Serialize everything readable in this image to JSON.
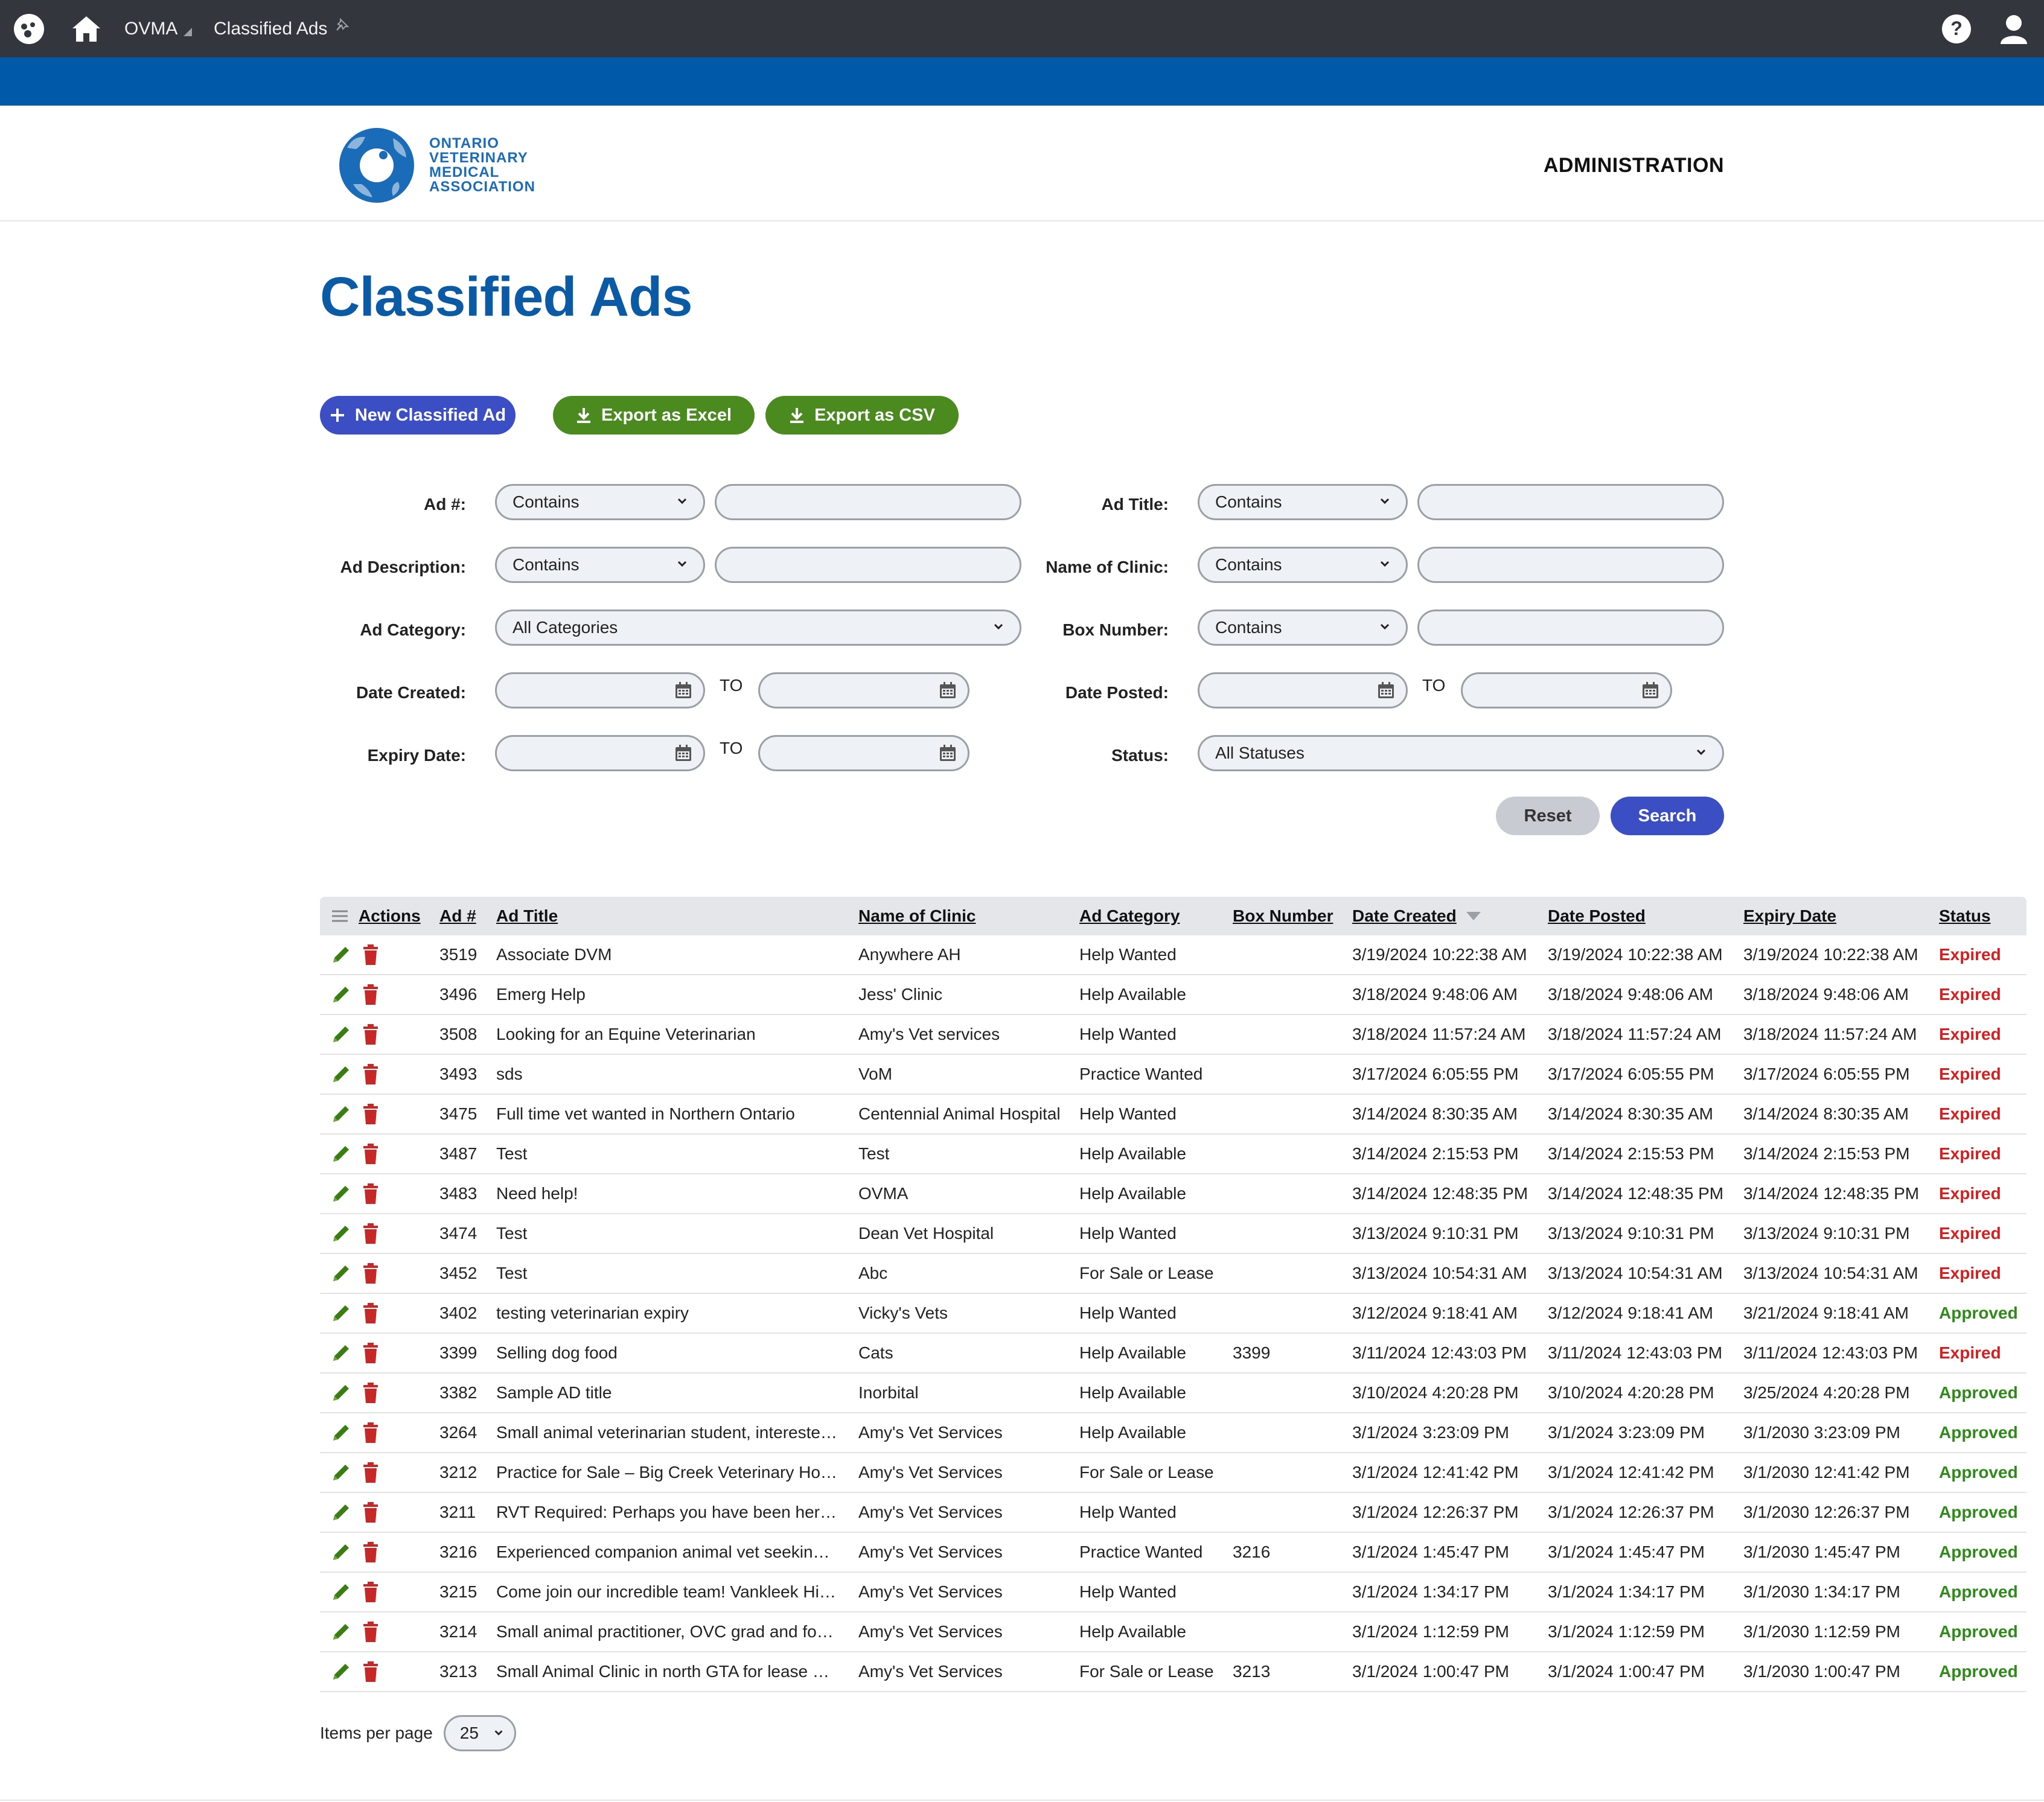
{
  "topbar": {
    "site_name": "OVMA",
    "page_name": "Classified Ads"
  },
  "header": {
    "logo_lines": [
      "ONTARIO",
      "VETERINARY",
      "MEDICAL",
      "ASSOCIATION"
    ],
    "admin_label": "ADMINISTRATION"
  },
  "page": {
    "title": "Classified Ads"
  },
  "toolbar": {
    "new_label": "New Classified Ad",
    "excel_label": "Export as Excel",
    "csv_label": "Export as CSV"
  },
  "filters": {
    "ad_num_label": "Ad #:",
    "ad_num_op": "Contains",
    "ad_title_label": "Ad Title:",
    "ad_title_op": "Contains",
    "ad_desc_label": "Ad Description:",
    "ad_desc_op": "Contains",
    "clinic_label": "Name of Clinic:",
    "clinic_op": "Contains",
    "category_label": "Ad Category:",
    "category_value": "All Categories",
    "box_label": "Box Number:",
    "box_op": "Contains",
    "date_created_label": "Date Created:",
    "date_posted_label": "Date Posted:",
    "expiry_label": "Expiry Date:",
    "status_label": "Status:",
    "status_value": "All Statuses",
    "to_label": "TO",
    "reset_label": "Reset",
    "search_label": "Search"
  },
  "table": {
    "headers": {
      "actions": "Actions",
      "ad_num": "Ad #",
      "title": "Ad Title",
      "clinic": "Name of Clinic",
      "category": "Ad Category",
      "box": "Box Number",
      "created": "Date Created",
      "posted": "Date Posted",
      "expiry": "Expiry Date",
      "status": "Status"
    },
    "rows": [
      {
        "ad_num": "3519",
        "title": "Associate DVM",
        "clinic": "Anywhere AH",
        "category": "Help Wanted",
        "box": "",
        "created": "3/19/2024 10:22:38 AM",
        "posted": "3/19/2024 10:22:38 AM",
        "expiry": "3/19/2024 10:22:38 AM",
        "status": "Expired"
      },
      {
        "ad_num": "3496",
        "title": "Emerg Help",
        "clinic": "Jess' Clinic",
        "category": "Help Available",
        "box": "",
        "created": "3/18/2024 9:48:06 AM",
        "posted": "3/18/2024 9:48:06 AM",
        "expiry": "3/18/2024 9:48:06 AM",
        "status": "Expired"
      },
      {
        "ad_num": "3508",
        "title": "Looking for an Equine Veterinarian",
        "clinic": "Amy's Vet services",
        "category": "Help Wanted",
        "box": "",
        "created": "3/18/2024 11:57:24 AM",
        "posted": "3/18/2024 11:57:24 AM",
        "expiry": "3/18/2024 11:57:24 AM",
        "status": "Expired"
      },
      {
        "ad_num": "3493",
        "title": "sds",
        "clinic": "VoM",
        "category": "Practice Wanted",
        "box": "",
        "created": "3/17/2024 6:05:55 PM",
        "posted": "3/17/2024 6:05:55 PM",
        "expiry": "3/17/2024 6:05:55 PM",
        "status": "Expired"
      },
      {
        "ad_num": "3475",
        "title": "Full time vet wanted in Northern Ontario",
        "clinic": "Centennial Animal Hospital",
        "category": "Help Wanted",
        "box": "",
        "created": "3/14/2024 8:30:35 AM",
        "posted": "3/14/2024 8:30:35 AM",
        "expiry": "3/14/2024 8:30:35 AM",
        "status": "Expired"
      },
      {
        "ad_num": "3487",
        "title": "Test",
        "clinic": "Test",
        "category": "Help Available",
        "box": "",
        "created": "3/14/2024 2:15:53 PM",
        "posted": "3/14/2024 2:15:53 PM",
        "expiry": "3/14/2024 2:15:53 PM",
        "status": "Expired"
      },
      {
        "ad_num": "3483",
        "title": "Need help!",
        "clinic": "OVMA",
        "category": "Help Available",
        "box": "",
        "created": "3/14/2024 12:48:35 PM",
        "posted": "3/14/2024 12:48:35 PM",
        "expiry": "3/14/2024 12:48:35 PM",
        "status": "Expired"
      },
      {
        "ad_num": "3474",
        "title": "Test",
        "clinic": "Dean Vet Hospital",
        "category": "Help Wanted",
        "box": "",
        "created": "3/13/2024 9:10:31 PM",
        "posted": "3/13/2024 9:10:31 PM",
        "expiry": "3/13/2024 9:10:31 PM",
        "status": "Expired"
      },
      {
        "ad_num": "3452",
        "title": "Test",
        "clinic": "Abc",
        "category": "For Sale or Lease",
        "box": "",
        "created": "3/13/2024 10:54:31 AM",
        "posted": "3/13/2024 10:54:31 AM",
        "expiry": "3/13/2024 10:54:31 AM",
        "status": "Expired"
      },
      {
        "ad_num": "3402",
        "title": "testing veterinarian expiry",
        "clinic": "Vicky's Vets",
        "category": "Help Wanted",
        "box": "",
        "created": "3/12/2024 9:18:41 AM",
        "posted": "3/12/2024 9:18:41 AM",
        "expiry": "3/21/2024 9:18:41 AM",
        "status": "Approved"
      },
      {
        "ad_num": "3399",
        "title": "Selling dog food",
        "clinic": "Cats",
        "category": "Help Available",
        "box": "3399",
        "created": "3/11/2024 12:43:03 PM",
        "posted": "3/11/2024 12:43:03 PM",
        "expiry": "3/11/2024 12:43:03 PM",
        "status": "Expired"
      },
      {
        "ad_num": "3382",
        "title": "Sample AD title",
        "clinic": "Inorbital",
        "category": "Help Available",
        "box": "",
        "created": "3/10/2024 4:20:28 PM",
        "posted": "3/10/2024 4:20:28 PM",
        "expiry": "3/25/2024 4:20:28 PM",
        "status": "Approved"
      },
      {
        "ad_num": "3264",
        "title": "Small animal veterinarian student, intereste…",
        "clinic": "Amy's Vet Services",
        "category": "Help Available",
        "box": "",
        "created": "3/1/2024 3:23:09 PM",
        "posted": "3/1/2024 3:23:09 PM",
        "expiry": "3/1/2030 3:23:09 PM",
        "status": "Approved"
      },
      {
        "ad_num": "3212",
        "title": "Practice for Sale – Big Creek Veterinary Ho…",
        "clinic": "Amy's Vet Services",
        "category": "For Sale or Lease",
        "box": "",
        "created": "3/1/2024 12:41:42 PM",
        "posted": "3/1/2024 12:41:42 PM",
        "expiry": "3/1/2030 12:41:42 PM",
        "status": "Approved"
      },
      {
        "ad_num": "3211",
        "title": "RVT Required: Perhaps you have been her…",
        "clinic": "Amy's Vet Services",
        "category": "Help Wanted",
        "box": "",
        "created": "3/1/2024 12:26:37 PM",
        "posted": "3/1/2024 12:26:37 PM",
        "expiry": "3/1/2030 12:26:37 PM",
        "status": "Approved"
      },
      {
        "ad_num": "3216",
        "title": "Experienced companion animal vet seekin…",
        "clinic": "Amy's Vet Services",
        "category": "Practice Wanted",
        "box": "3216",
        "created": "3/1/2024 1:45:47 PM",
        "posted": "3/1/2024 1:45:47 PM",
        "expiry": "3/1/2030 1:45:47 PM",
        "status": "Approved"
      },
      {
        "ad_num": "3215",
        "title": "Come join our incredible team! Vankleek Hi…",
        "clinic": "Amy's Vet Services",
        "category": "Help Wanted",
        "box": "",
        "created": "3/1/2024 1:34:17 PM",
        "posted": "3/1/2024 1:34:17 PM",
        "expiry": "3/1/2030 1:34:17 PM",
        "status": "Approved"
      },
      {
        "ad_num": "3214",
        "title": "Small animal practitioner, OVC grad and fo…",
        "clinic": "Amy's Vet Services",
        "category": "Help Available",
        "box": "",
        "created": "3/1/2024 1:12:59 PM",
        "posted": "3/1/2024 1:12:59 PM",
        "expiry": "3/1/2030 1:12:59 PM",
        "status": "Approved"
      },
      {
        "ad_num": "3213",
        "title": "Small Animal Clinic in north GTA for lease …",
        "clinic": "Amy's Vet Services",
        "category": "For Sale or Lease",
        "box": "3213",
        "created": "3/1/2024 1:00:47 PM",
        "posted": "3/1/2024 1:00:47 PM",
        "expiry": "3/1/2030 1:00:47 PM",
        "status": "Approved"
      }
    ]
  },
  "pagination": {
    "items_per_page_label": "Items per page",
    "items_per_page_value": "25"
  },
  "colors": {
    "topbar": "#33363d",
    "bluebar": "#005aaa",
    "title": "#0b5aa6",
    "primary_button": "#3b4ec4",
    "export_button": "#4a8a1e",
    "expired": "#d42020",
    "approved": "#2e8b1a",
    "edit_icon": "#3a7d12",
    "delete_icon": "#c62828"
  },
  "icons": [
    "drupal-icon",
    "home-icon",
    "pin-icon",
    "help-icon",
    "user-icon",
    "plus-icon",
    "download-icon",
    "chevron-down-icon",
    "calendar-icon",
    "menu-icon",
    "sort-desc-icon",
    "edit-icon",
    "delete-icon"
  ]
}
